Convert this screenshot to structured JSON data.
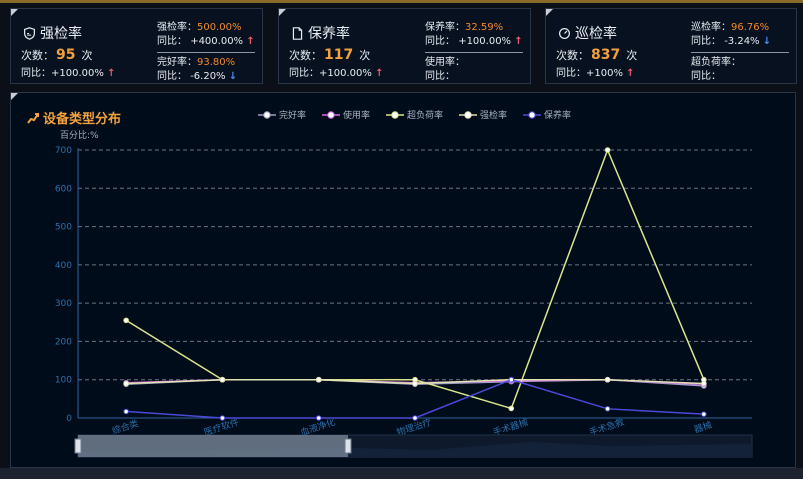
{
  "cards": [
    {
      "title": "强检率",
      "count_label": "次数：",
      "count": "95",
      "count_unit": "次",
      "yoy_label": "同比：",
      "yoy": "+100.00%",
      "right": [
        {
          "label": "强检率：",
          "value": "500.00%",
          "yoy_label": "同比：",
          "yoy": "+400.00%",
          "dir": "up"
        },
        {
          "label": "完好率：",
          "value": "93.80%",
          "yoy_label": "同比：",
          "yoy": "-6.20%",
          "dir": "down"
        }
      ]
    },
    {
      "title": "保养率",
      "count_label": "次数：",
      "count": "117",
      "count_unit": "次",
      "yoy_label": "同比：",
      "yoy": "+100.00%",
      "right": [
        {
          "label": "保养率：",
          "value": "32.59%",
          "yoy_label": "同比：",
          "yoy": "+100.00%",
          "dir": "up"
        },
        {
          "label": "使用率：",
          "value": "",
          "yoy_label": "同比：",
          "yoy": "",
          "dir": ""
        }
      ]
    },
    {
      "title": "巡检率",
      "count_label": "次数：",
      "count": "837",
      "count_unit": "次",
      "yoy_label": "同比：",
      "yoy": "+100%",
      "right": [
        {
          "label": "巡检率：",
          "value": "96.76%",
          "yoy_label": "同比：",
          "yoy": "-3.24%",
          "dir": "down"
        },
        {
          "label": "超负荷率：",
          "value": "",
          "yoy_label": "同比：",
          "yoy": "",
          "dir": ""
        }
      ]
    }
  ],
  "panel_title": "设备类型分布",
  "chart_data": {
    "type": "line",
    "title": "设备类型分布",
    "ylabel": "百分比:%",
    "xlabel": "",
    "ylim": [
      0,
      700
    ],
    "yticks": [
      0,
      100,
      200,
      300,
      400,
      500,
      600,
      700
    ],
    "grid": true,
    "legend": "top-center",
    "categories": [
      "综合类",
      "医疗软件",
      "血液净化",
      "物理治疗",
      "手术器械",
      "手术急救",
      "器械"
    ],
    "series": [
      {
        "name": "完好率",
        "color": "#9d9fc8",
        "values": [
          88,
          100,
          100,
          88,
          95,
          100,
          84
        ]
      },
      {
        "name": "使用率",
        "color": "#d86ae0",
        "values": [
          92,
          100,
          100,
          92,
          97,
          100,
          88
        ]
      },
      {
        "name": "超负荷率",
        "color": "#d9e58a",
        "values": [
          255,
          100,
          100,
          100,
          25,
          700,
          100
        ]
      },
      {
        "name": "强检率",
        "color": "#e0e2b0",
        "values": [
          90,
          100,
          100,
          90,
          100,
          100,
          90
        ]
      },
      {
        "name": "保养率",
        "color": "#4a4ad8",
        "values": [
          17,
          0,
          0,
          0,
          100,
          24,
          10
        ]
      }
    ]
  }
}
